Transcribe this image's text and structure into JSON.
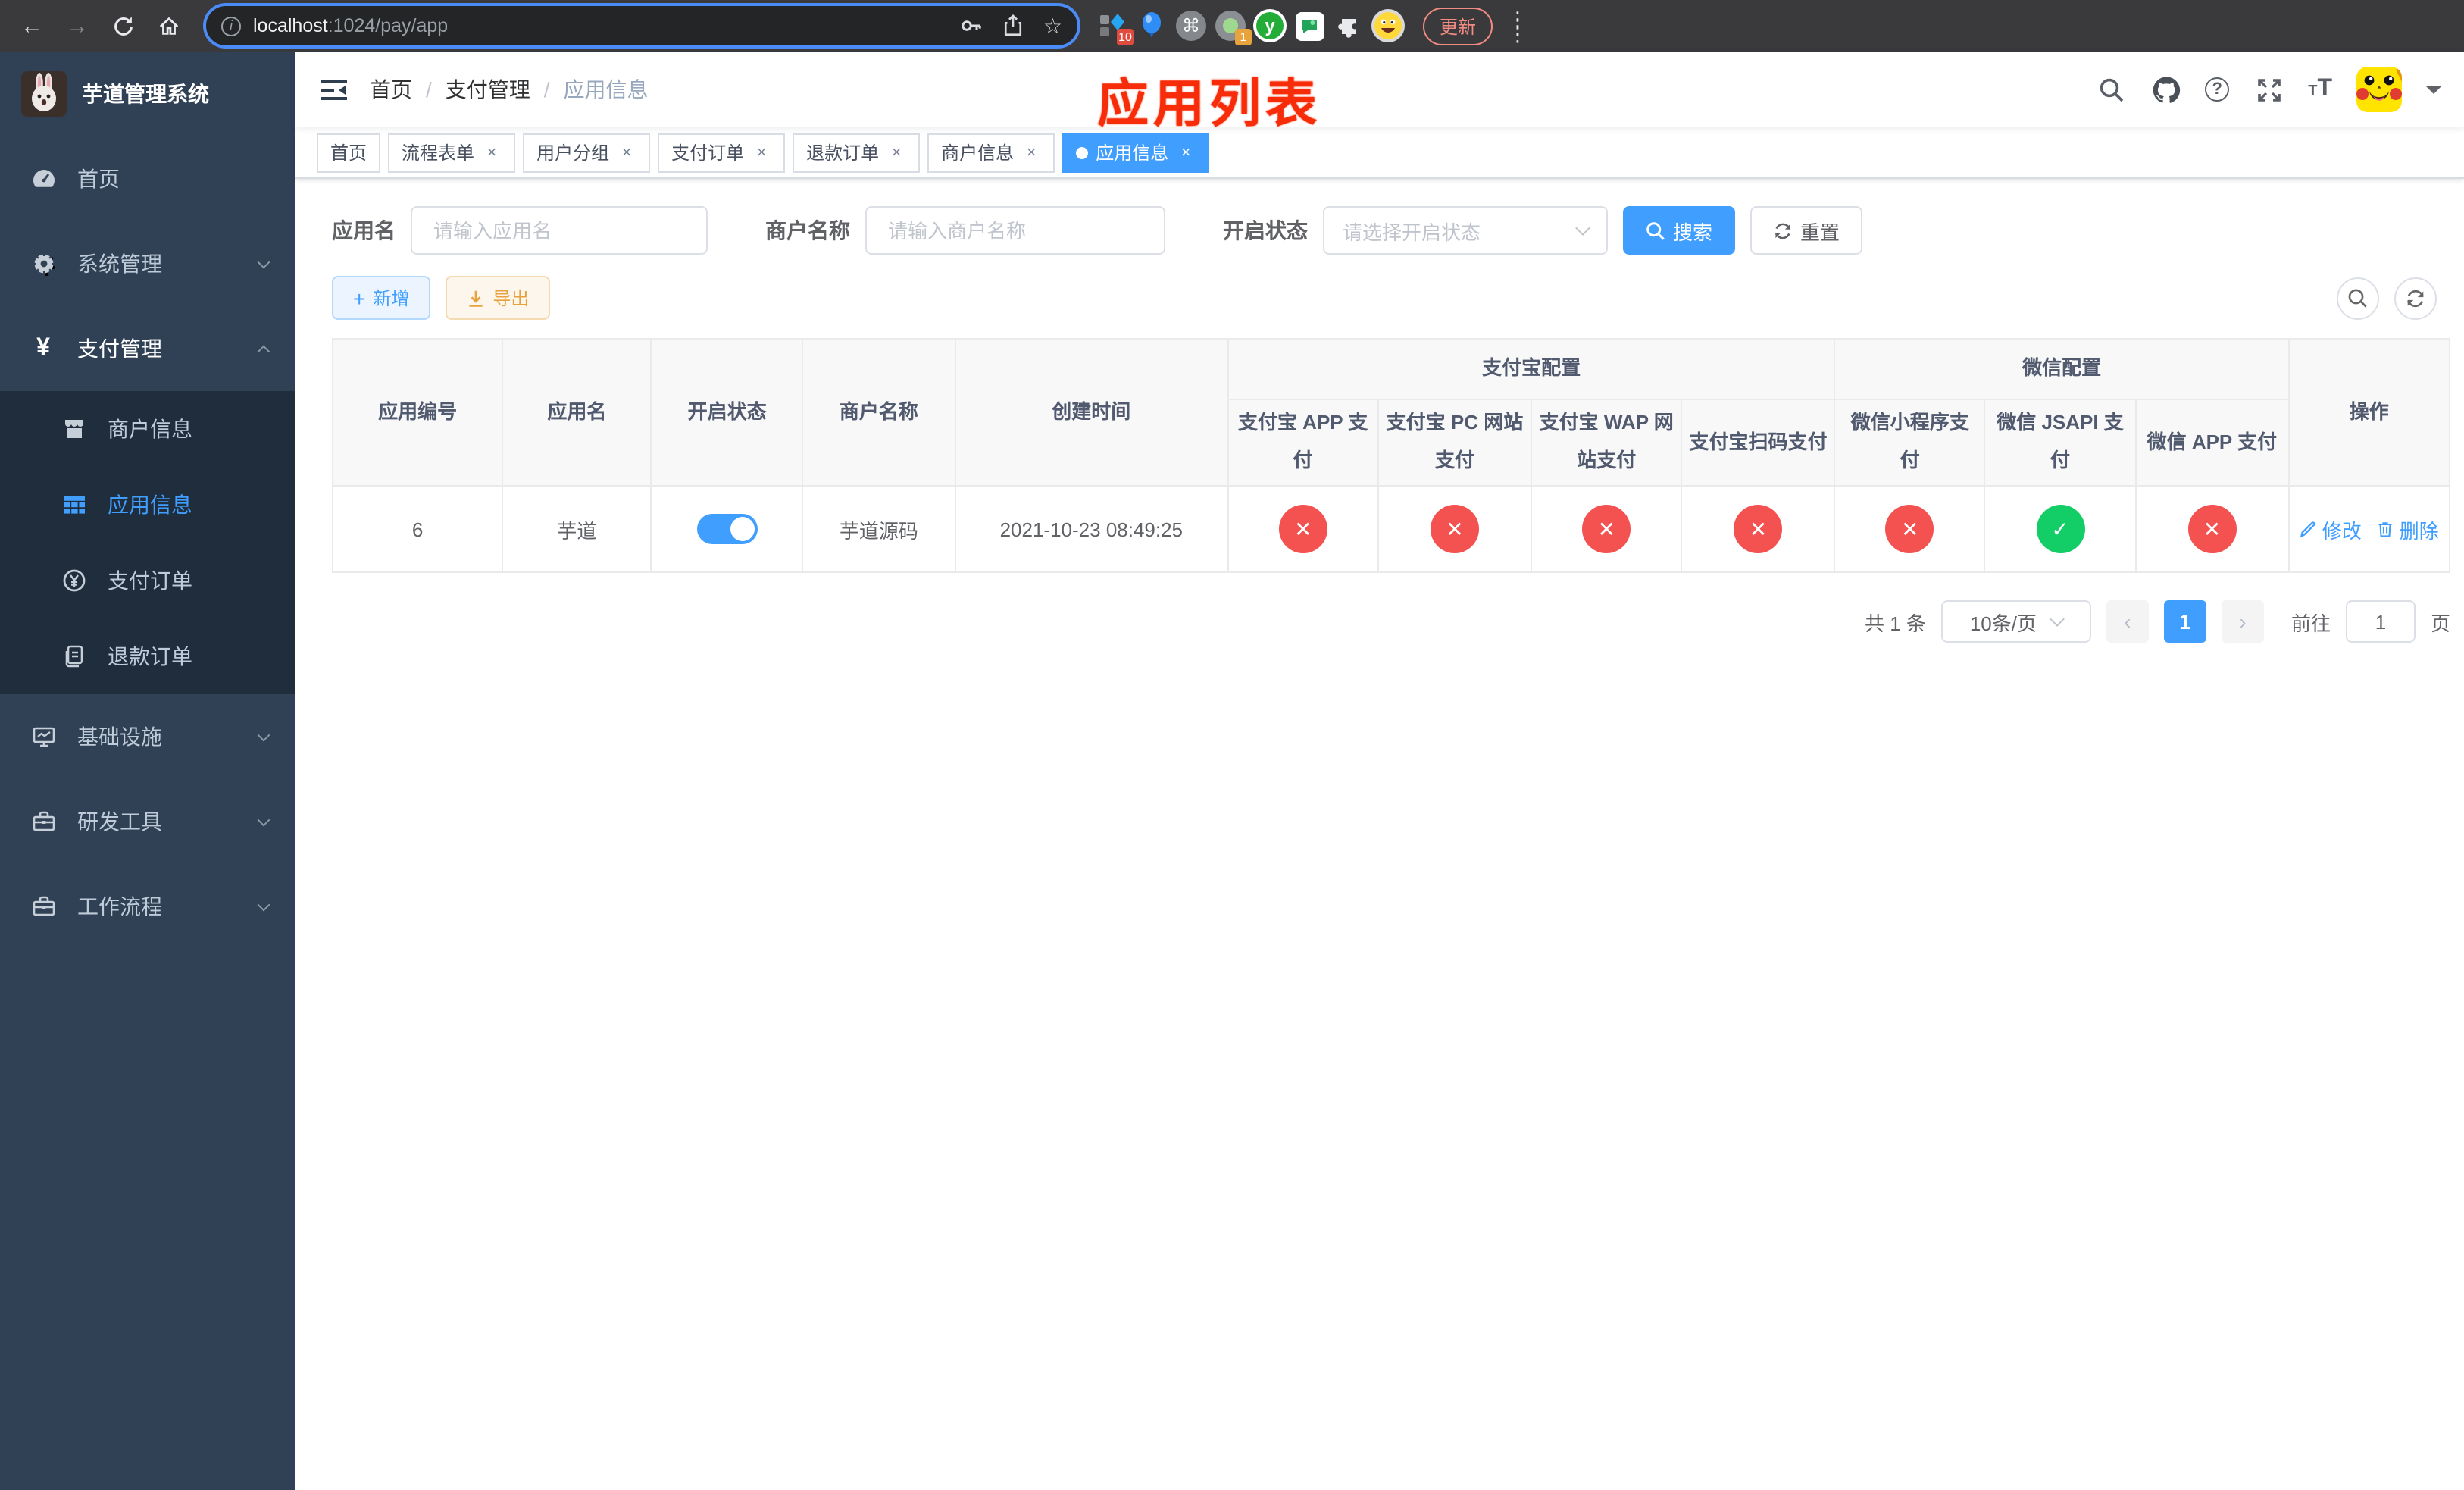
{
  "browser": {
    "url": {
      "host": "localhost",
      "path": ":1024/pay/app"
    },
    "update_button": "更新",
    "extension_badges": {
      "pieces": "10",
      "one": "1"
    }
  },
  "colors": {
    "accent": "#409eff",
    "success": "#13ce66",
    "danger": "#f45151",
    "warning": "#e6a23c",
    "sidebar_bg": "#304156",
    "submenu_bg": "#1f2d3d",
    "annotation_red": "#f72c08"
  },
  "sidebar": {
    "title": "芋道管理系统",
    "menu": [
      {
        "label": "首页"
      },
      {
        "label": "系统管理"
      },
      {
        "label": "支付管理"
      },
      {
        "label": "商户信息"
      },
      {
        "label": "应用信息"
      },
      {
        "label": "支付订单"
      },
      {
        "label": "退款订单"
      },
      {
        "label": "基础设施"
      },
      {
        "label": "研发工具"
      },
      {
        "label": "工作流程"
      }
    ]
  },
  "breadcrumb": {
    "items": [
      "首页",
      "支付管理",
      "应用信息"
    ]
  },
  "annotation": "应用列表",
  "tabs": [
    {
      "label": "首页"
    },
    {
      "label": "流程表单"
    },
    {
      "label": "用户分组"
    },
    {
      "label": "支付订单"
    },
    {
      "label": "退款订单"
    },
    {
      "label": "商户信息"
    },
    {
      "label": "应用信息"
    }
  ],
  "filters": {
    "app_name_label": "应用名",
    "app_name_placeholder": "请输入应用名",
    "merchant_label": "商户名称",
    "merchant_placeholder": "请输入商户名称",
    "status_label": "开启状态",
    "status_placeholder": "请选择开启状态",
    "search_button": "搜索",
    "reset_button": "重置"
  },
  "toolbar": {
    "add_button": "新增",
    "export_button": "导出"
  },
  "table": {
    "headers": {
      "app_id": "应用编号",
      "app_name": "应用名",
      "status": "开启状态",
      "merchant": "商户名称",
      "create_time": "创建时间",
      "alipay_group": "支付宝配置",
      "wechat_group": "微信配置",
      "alipay_app": "支付宝 APP 支付",
      "alipay_pc": "支付宝 PC 网站支付",
      "alipay_wap": "支付宝 WAP 网站支付",
      "alipay_qr": "支付宝扫码支付",
      "wx_mini": "微信小程序支付",
      "wx_jsapi": "微信 JSAPI 支付",
      "wx_app": "微信 APP 支付",
      "actions": "操作"
    },
    "row": {
      "id": "6",
      "name": "芋道",
      "switch": "on",
      "merchant": "芋道源码",
      "create_time": "2021-10-23 08:49:25",
      "statuses": [
        "off",
        "off",
        "off",
        "off",
        "off",
        "on",
        "off"
      ],
      "edit": "修改",
      "delete": "删除"
    }
  },
  "pagination": {
    "total": "共 1 条",
    "page_size": "10条/页",
    "prev": "‹",
    "next": "›",
    "current_page": "1",
    "goto_label": "前往",
    "goto_value": "1",
    "page_suffix": "页"
  }
}
